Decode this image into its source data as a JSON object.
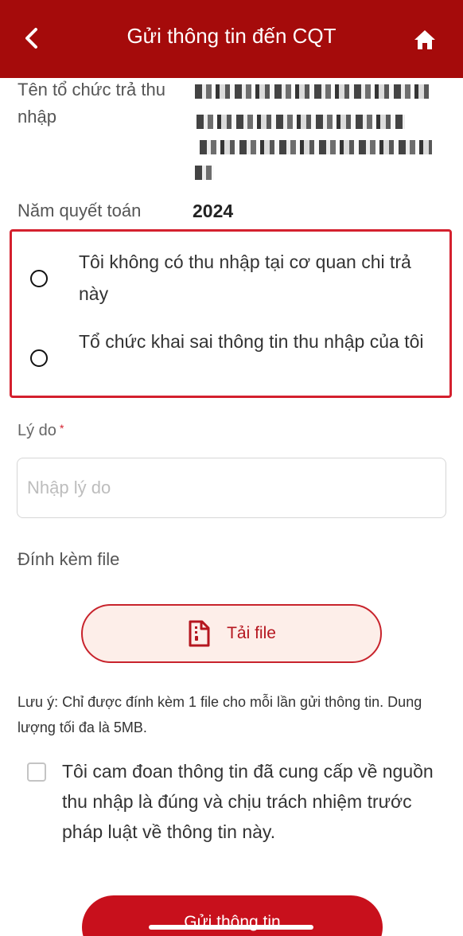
{
  "header": {
    "title": "Gửi thông tin đến CQT",
    "back_icon": "chevron-left-icon",
    "home_icon": "home-icon",
    "background": "#a50b0b"
  },
  "info": {
    "org_label": "Tên tổ chức trả thu nhập",
    "year_label": "Năm quyết toán",
    "year_value": "2024"
  },
  "options": [
    {
      "label": "Tôi không có thu nhập tại cơ quan chi trả này",
      "selected": false
    },
    {
      "label": "Tổ chức khai sai thông tin thu nhập của tôi",
      "selected": false
    }
  ],
  "reason": {
    "label": "Lý do",
    "required_mark": "*",
    "placeholder": "Nhập lý do",
    "value": ""
  },
  "attachment": {
    "label": "Đính kèm file",
    "button_label": "Tải file",
    "button_icon": "file-icon",
    "note": "Lưu ý: Chỉ được đính kèm 1 file cho mỗi lần gửi thông tin. Dung lượng tối đa là 5MB."
  },
  "commitment": {
    "text": "Tôi cam đoan thông tin đã cung cấp về nguồn thu nhập là đúng và chịu trách nhiệm trước pháp luật về thông tin này.",
    "checked": false
  },
  "submit": {
    "label": "Gửi thông tin"
  },
  "colors": {
    "accent": "#c8101c",
    "highlight_border": "#d4202e",
    "upload_bg": "#fdeee9"
  }
}
